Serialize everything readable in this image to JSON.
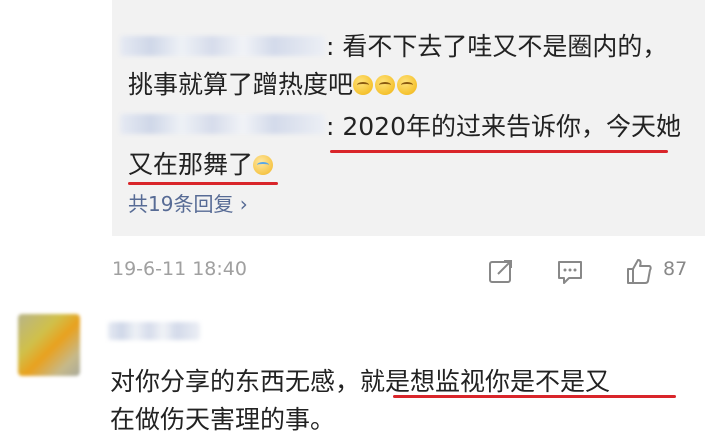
{
  "replies": [
    {
      "text_line1": ": 看不下去了哇又不是圈内的，",
      "text_line2": "挑事就算了蹭热度吧",
      "emojis": 3
    },
    {
      "text_line1": ": 2020年的过来告诉你，今天她",
      "text_line2": "又在那舞了",
      "emojis": 1
    }
  ],
  "more_replies": "共19条回复 ›",
  "timestamp": "19-6-11 18:40",
  "actions": {
    "like_count": "87",
    "icons": [
      "share-icon",
      "comment-icon",
      "like-icon"
    ]
  },
  "comment": {
    "line1": "对你分享的东西无感，就是想监视你是不是又",
    "line2": "在做伤天害理的事。"
  },
  "colors": {
    "reply_bg": "#f2f2f2",
    "link": "#576b95",
    "underline": "#d9252a",
    "muted": "#a0a0a0"
  }
}
